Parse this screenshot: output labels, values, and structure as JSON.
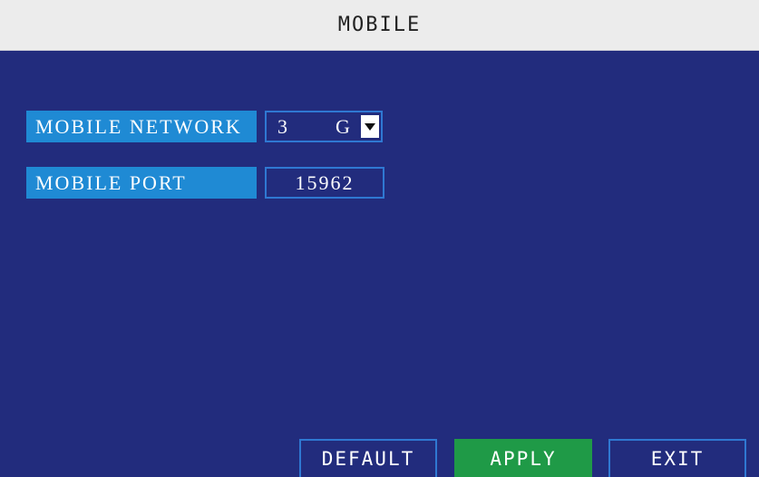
{
  "window": {
    "title": "MOBILE"
  },
  "form": {
    "network": {
      "label": "MOBILE NETWORK",
      "value_part1": "3",
      "value_part2": "G"
    },
    "port": {
      "label": "MOBILE PORT",
      "value": "15962"
    }
  },
  "buttons": {
    "default_label": "DEFAULT",
    "apply_label": "APPLY",
    "exit_label": "EXIT"
  },
  "colors": {
    "background": "#222c7d",
    "titlebar": "#ececec",
    "label_bg": "#1f8ad4",
    "apply_bg": "#1f9a47",
    "border": "#2f78d2"
  },
  "icons": {
    "dropdown": "chevron-down-icon"
  }
}
